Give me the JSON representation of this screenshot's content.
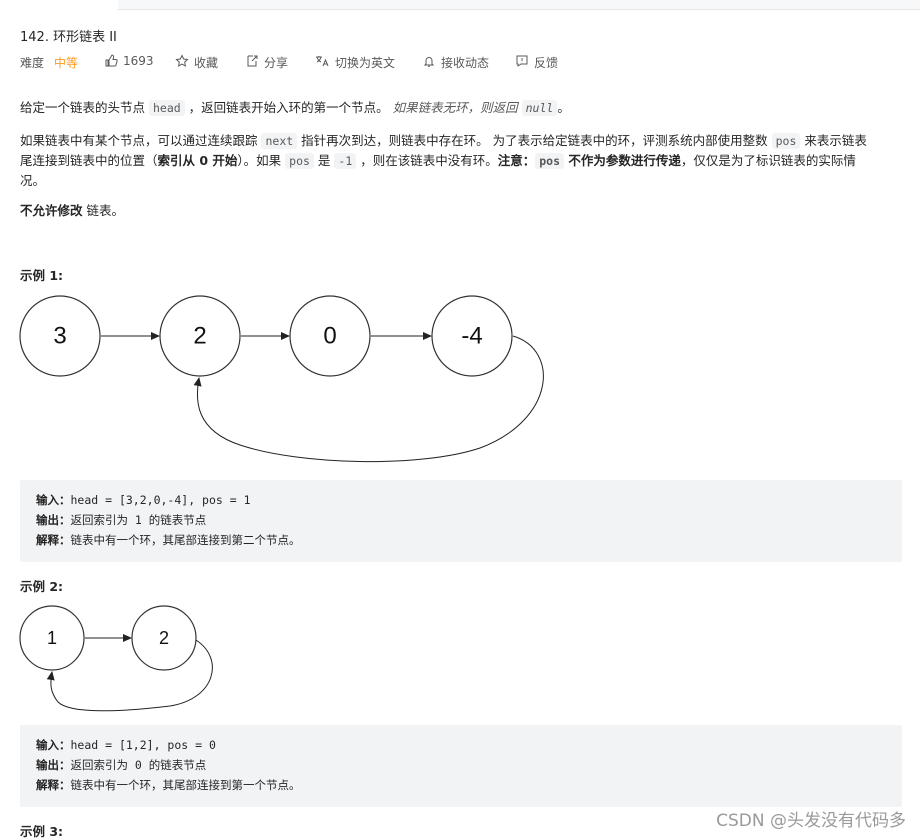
{
  "problem": {
    "title": "142. 环形链表 II",
    "difficulty_label": "难度",
    "difficulty": "中等",
    "likes": "1693",
    "favorite": "收藏",
    "share": "分享",
    "switch_lang": "切换为英文",
    "notify": "接收动态",
    "feedback": "反馈"
  },
  "description": {
    "p1_a": "给定一个链表的头节点 ",
    "p1_code": "head",
    "p1_b": " ，返回链表开始入环的第一个节点。 ",
    "p1_i": "如果链表无环，则返回 ",
    "p1_code2": "null",
    "p1_end": "。",
    "p2_a": "如果链表中有某个节点，可以通过连续跟踪 ",
    "p2_code1": "next",
    "p2_b": " 指针再次到达，则链表中存在环。 为了表示给定链表中的环，评测系统内部使用整数 ",
    "p2_code2": "pos",
    "p2_c": " 来表示链表",
    "p2_line2_a": "尾连接到链表中的位置（",
    "p2_line2_b": "索引从 0 开始",
    "p2_line2_c": "）。如果 ",
    "p2_code3": "pos",
    "p2_line2_d": " 是 ",
    "p2_code4": "-1",
    "p2_line2_e": " ，则在该链表中没有环。",
    "p2_line2_f": "注意：",
    "p2_code5": "pos",
    "p2_line2_g": " 不作为参数进行传递",
    "p2_line2_h": "，仅仅是为了标识链表的实际情",
    "p2_line3": "况。",
    "p3_b": "不允许修改",
    "p3_rest": " 链表。"
  },
  "example1": {
    "title": "示例 1:",
    "nodes": [
      "3",
      "2",
      "0",
      "-4"
    ],
    "input_label": "输入：",
    "input": "head = [3,2,0,-4], pos = 1",
    "output_label": "输出：",
    "output": "返回索引为 1 的链表节点",
    "explain_label": "解释：",
    "explain": "链表中有一个环，其尾部连接到第二个节点。"
  },
  "example2": {
    "title": "示例 2:",
    "nodes": [
      "1",
      "2"
    ],
    "input_label": "输入：",
    "input": "head = [1,2], pos = 0",
    "output_label": "输出：",
    "output": "返回索引为 0 的链表节点",
    "explain_label": "解释：",
    "explain": "链表中有一个环，其尾部连接到第一个节点。"
  },
  "example3": {
    "title": "示例 3:"
  },
  "watermark": "CSDN @头发没有代码多"
}
